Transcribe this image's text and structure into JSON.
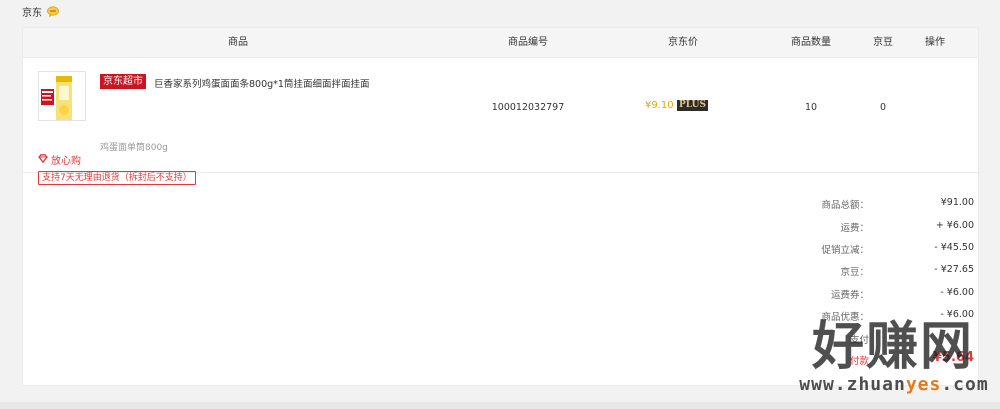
{
  "shop": {
    "name": "京东",
    "icon": "chat-bubble-icon"
  },
  "table_headers": {
    "goods": "商品",
    "sku": "商品编号",
    "price": "京东价",
    "qty": "商品数量",
    "bean": "京豆",
    "op": "操作"
  },
  "product": {
    "badge": "京东超市",
    "title": "巨香家系列鸡蛋面面条800g*1筒挂面细面拌面挂面",
    "spec": "鸡蛋面单筒800g",
    "assure": "放心购",
    "return_policy": "支持7天无理由退货（拆封后不支持）",
    "sku_no": "100012032797",
    "price": "¥9.10",
    "plus": "PLUS",
    "qty": "10",
    "bean": "0",
    "thumb_icon": "product-thumbnail"
  },
  "summary": [
    {
      "label": "商品总额：",
      "value": "¥91.00"
    },
    {
      "label": "运费：",
      "value": "+ ¥6.00"
    },
    {
      "label": "促销立减：",
      "value": "- ¥45.50"
    },
    {
      "label": "京豆：",
      "value": "- ¥27.65"
    },
    {
      "label": "运费券：",
      "value": "- ¥6.00"
    },
    {
      "label": "商品优惠：",
      "value": "- ¥6.00"
    },
    {
      "label": "支付",
      "value": ""
    },
    {
      "label": "付款",
      "value": "¥5.64"
    }
  ],
  "watermark": {
    "main": "好赚网",
    "sub_pre": "www.zhuan",
    "sub_accent": "yes",
    "sub_post": ".com"
  },
  "colors": {
    "brand_red": "#e4393c",
    "jd_red": "#c81623",
    "price_gold": "#e4a600",
    "plus_bg": "#2b2b2b"
  }
}
